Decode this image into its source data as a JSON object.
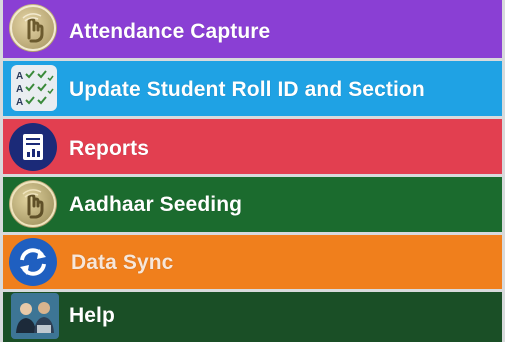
{
  "menu": {
    "items": [
      {
        "label": "Attendance Capture",
        "icon": "fingerprint-hand-icon",
        "color": "#8a3fd4"
      },
      {
        "label": "Update Student Roll ID and Section",
        "icon": "checklist-icon",
        "color": "#1fa2e4"
      },
      {
        "label": "Reports",
        "icon": "report-document-icon",
        "color": "#e23f50"
      },
      {
        "label": "Aadhaar Seeding",
        "icon": "fingerprint-hand-icon",
        "color": "#1b6b2e"
      },
      {
        "label": "Data Sync",
        "icon": "sync-icon",
        "color": "#f07f1c"
      },
      {
        "label": "Help",
        "icon": "help-people-icon",
        "color": "#1a4f26"
      }
    ]
  }
}
